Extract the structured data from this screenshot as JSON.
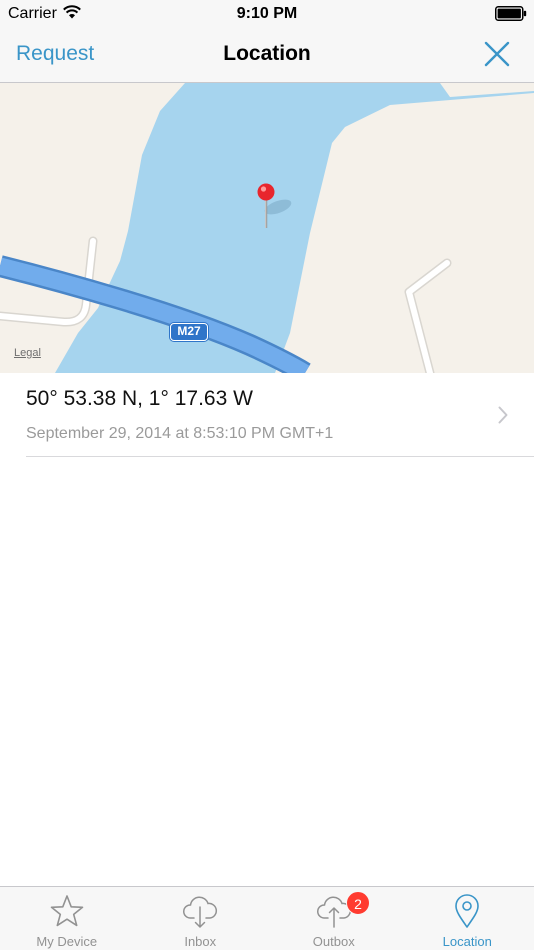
{
  "status_bar": {
    "carrier": "Carrier",
    "time": "9:10 PM"
  },
  "nav": {
    "left_button": "Request",
    "title": "Location",
    "close_icon": "close-icon"
  },
  "map": {
    "legal_link": "Legal",
    "road_label": "M27",
    "colors": {
      "land": "#f5f1ea",
      "water": "#a6d4ee",
      "road": "#6aa9e8",
      "pin": "#e8262d"
    }
  },
  "location": {
    "coordinates": "50° 53.38 N, 1° 17.63 W",
    "timestamp": "September 29, 2014 at 8:53:10 PM GMT+1"
  },
  "tabs": [
    {
      "label": "My Device",
      "icon": "star-icon",
      "active": false
    },
    {
      "label": "Inbox",
      "icon": "cloud-download-icon",
      "active": false
    },
    {
      "label": "Outbox",
      "icon": "cloud-upload-icon",
      "active": false,
      "badge": "2"
    },
    {
      "label": "Location",
      "icon": "location-pin-icon",
      "active": true
    }
  ],
  "colors": {
    "accent": "#3a95c8",
    "badge": "#ff3b30"
  }
}
